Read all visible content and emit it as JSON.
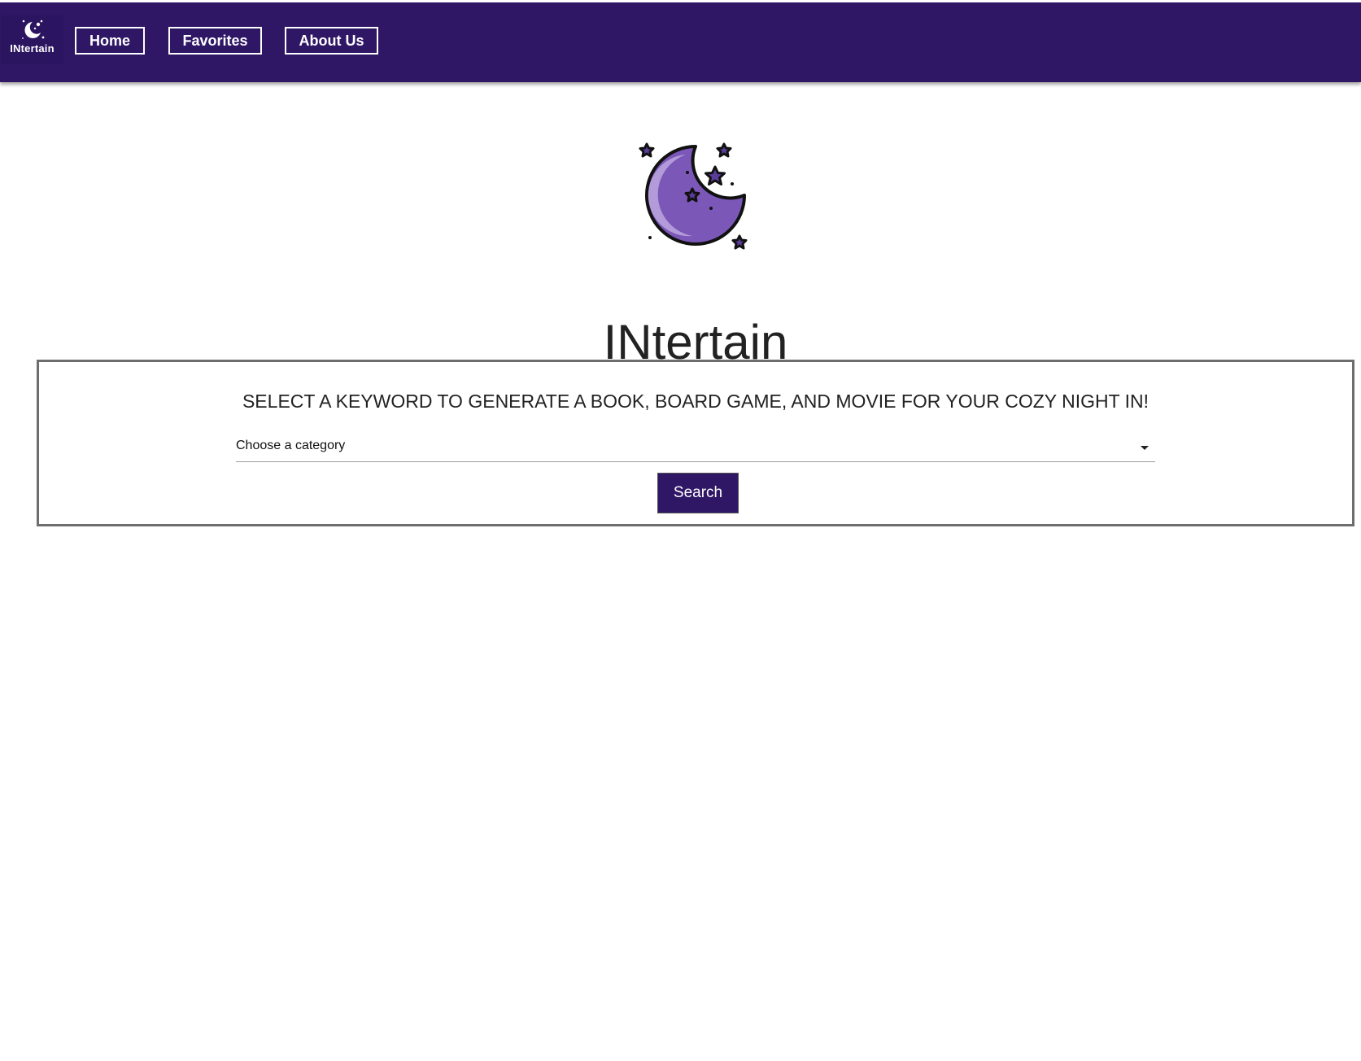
{
  "nav": {
    "logo_text": "INtertain",
    "items": [
      {
        "label": "Home"
      },
      {
        "label": "Favorites"
      },
      {
        "label": "About Us"
      }
    ]
  },
  "hero": {
    "title": "INtertain"
  },
  "search_card": {
    "heading": "SELECT A KEYWORD TO GENERATE A BOOK, BOARD GAME, AND MOVIE FOR YOUR COZY NIGHT IN!",
    "select_value": "Choose a category",
    "button_label": "Search"
  },
  "colors": {
    "nav_background": "#2f1766",
    "button_background": "#2f1766",
    "moon_purple": "#7b58b8",
    "moon_highlight": "#b39bd9"
  }
}
